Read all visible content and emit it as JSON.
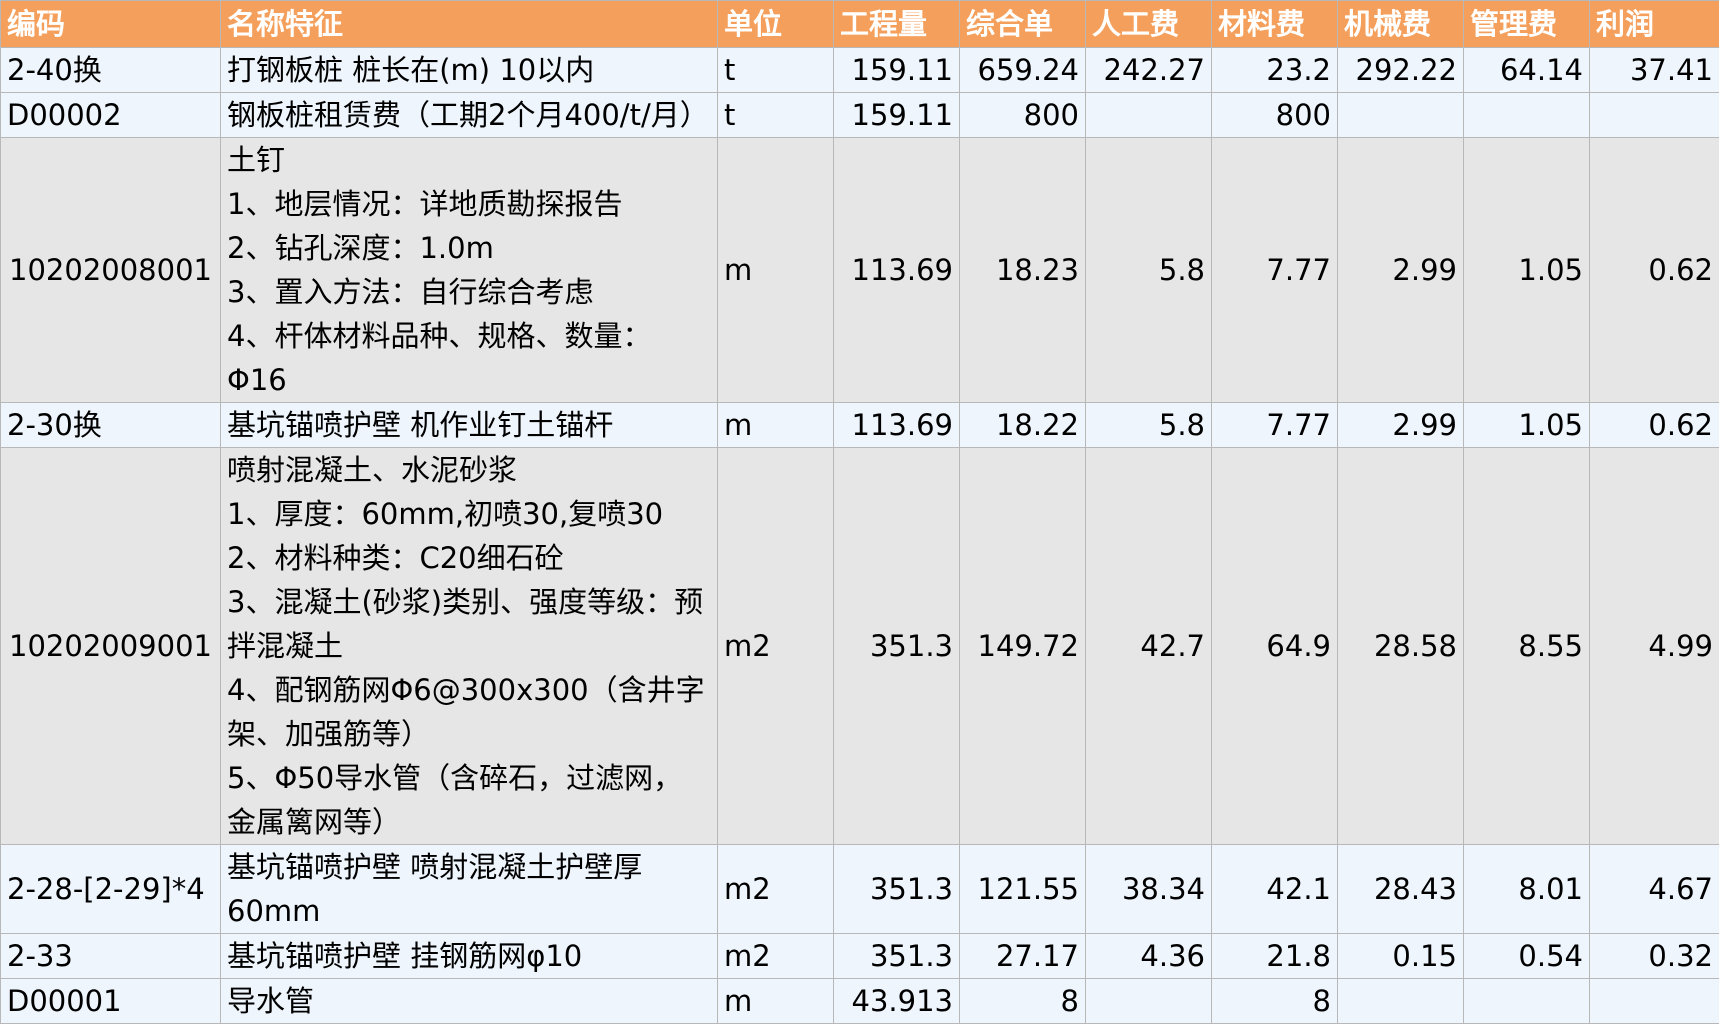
{
  "headers": [
    "编码",
    "名称特征",
    "单位",
    "工程量",
    "综合单",
    "人工费",
    "材料费",
    "机械费",
    "管理费",
    "利润"
  ],
  "rows": [
    {
      "code": "2-40换",
      "desc": [
        "打钢板桩 桩长在(m) 10以内"
      ],
      "unit": "t",
      "qty": "159.11",
      "unit_price": "659.24",
      "labor": "242.27",
      "material": "23.2",
      "machine": "292.22",
      "mgmt": "64.14",
      "profit": "37.41"
    },
    {
      "code": "D00002",
      "desc": [
        "钢板桩租赁费（工期2个月400/t/月）"
      ],
      "unit": "t",
      "qty": "159.11",
      "unit_price": "800",
      "labor": "",
      "material": "800",
      "machine": "",
      "mgmt": "",
      "profit": ""
    },
    {
      "code": "10202008001",
      "desc": [
        "土钉",
        "1、地层情况：详地质勘探报告",
        "2、钻孔深度：1.0m",
        "3、置入方法：自行综合考虑",
        "4、杆体材料品种、规格、数量：Φ16"
      ],
      "unit": "m",
      "qty": "113.69",
      "unit_price": "18.23",
      "labor": "5.8",
      "material": "7.77",
      "machine": "2.99",
      "mgmt": "1.05",
      "profit": "0.62"
    },
    {
      "code": "2-30换",
      "desc": [
        "基坑锚喷护壁 机作业钉土锚杆"
      ],
      "unit": "m",
      "qty": "113.69",
      "unit_price": "18.22",
      "labor": "5.8",
      "material": "7.77",
      "machine": "2.99",
      "mgmt": "1.05",
      "profit": "0.62"
    },
    {
      "code": "10202009001",
      "desc": [
        "喷射混凝土、水泥砂浆",
        "1、厚度：60mm,初喷30,复喷30",
        "2、材料种类：C20细石砼",
        "3、混凝土(砂浆)类别、强度等级：预拌混凝土",
        "4、配钢筋网Φ6@300x300（含井字架、加强筋等）",
        "5、Φ50导水管（含碎石，过滤网，金属篱网等）"
      ],
      "unit": "m2",
      "qty": "351.3",
      "unit_price": "149.72",
      "labor": "42.7",
      "material": "64.9",
      "machine": "28.58",
      "mgmt": "8.55",
      "profit": "4.99"
    },
    {
      "code": "2-28-[2-29]*4",
      "desc": [
        "基坑锚喷护壁 喷射混凝土护壁厚60mm"
      ],
      "unit": "m2",
      "qty": "351.3",
      "unit_price": "121.55",
      "labor": "38.34",
      "material": "42.1",
      "machine": "28.43",
      "mgmt": "8.01",
      "profit": "4.67"
    },
    {
      "code": "2-33",
      "desc": [
        "基坑锚喷护壁 挂钢筋网φ10"
      ],
      "unit": "m2",
      "qty": "351.3",
      "unit_price": "27.17",
      "labor": "4.36",
      "material": "21.8",
      "machine": "0.15",
      "mgmt": "0.54",
      "profit": "0.32"
    },
    {
      "code": "D00001",
      "desc": [
        "导水管"
      ],
      "unit": "m",
      "qty": "43.913",
      "unit_price": "8",
      "labor": "",
      "material": "8",
      "machine": "",
      "mgmt": "",
      "profit": ""
    }
  ],
  "colors": {
    "header_bg": "#f4a05c",
    "header_text": "#ffffff",
    "row_blue": "#eef5fc",
    "row_gray": "#e6e6e6",
    "grid": "#b8b8b8"
  }
}
